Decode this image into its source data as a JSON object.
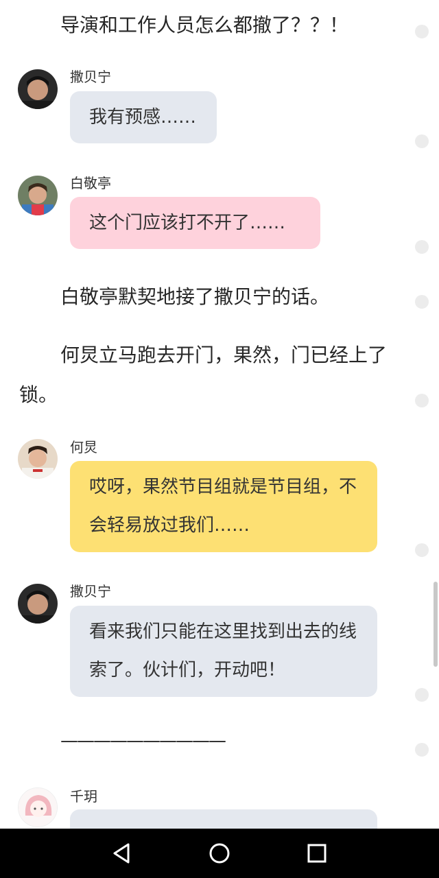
{
  "story": {
    "line_top": "导演和工作人员怎么都撤了？？！",
    "para_1": "白敬亭默契地接了撒贝宁的话。",
    "para_2": "何炅立马跑去开门，果然，门已经上了锁。",
    "divider": "——————————"
  },
  "messages": [
    {
      "speaker": "撒贝宁",
      "text": "我有预感……",
      "color": "#e4e8ef"
    },
    {
      "speaker": "白敬亭",
      "text": "这个门应该打不开了……",
      "color": "#fed2dc"
    },
    {
      "speaker": "何炅",
      "text": "哎呀，果然节目组就是节目组，不会轻易放过我们……",
      "color": "#fde073"
    },
    {
      "speaker": "撒贝宁",
      "text": "看来我们只能在这里找到出去的线索了。伙计们，开动吧！",
      "color": "#e4e8ef"
    },
    {
      "speaker": "千玥",
      "text": "",
      "color": "#e4e8ef"
    }
  ],
  "navbar": {
    "back_icon": "triangle-back-icon",
    "home_icon": "circle-home-icon",
    "recents_icon": "square-recents-icon"
  }
}
